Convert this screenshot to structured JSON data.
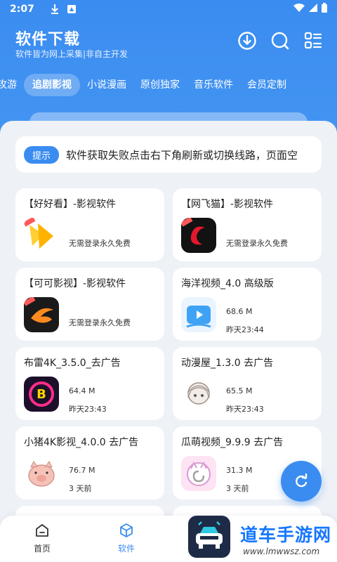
{
  "status_bar": {
    "time": "2:07"
  },
  "header": {
    "title": "软件下载",
    "subtitle": "软件皆为网上采集|非自主开发",
    "icons": [
      "download-icon",
      "search-icon",
      "menu-icon"
    ]
  },
  "tabs": [
    {
      "label": "攻游",
      "active": false
    },
    {
      "label": "追剧影视",
      "active": true
    },
    {
      "label": "小说漫画",
      "active": false
    },
    {
      "label": "原创独家",
      "active": false
    },
    {
      "label": "音乐软件",
      "active": false
    },
    {
      "label": "会员定制",
      "active": false
    }
  ],
  "notice": {
    "badge": "提示",
    "text": "软件获取失败点击右下角刷新或切换线路，页面空"
  },
  "apps": [
    {
      "title": "【好好看】-影视软件",
      "line1": "",
      "line2": "",
      "free": "无需登录永久免费",
      "icon": "haohaokan"
    },
    {
      "title": "【网飞猫】-影视软件",
      "line1": "",
      "line2": "",
      "free": "无需登录永久免费",
      "icon": "wangfeimao"
    },
    {
      "title": "【可可影视】-影视软件",
      "line1": "",
      "line2": "",
      "free": "无需登录永久免费",
      "icon": "keke"
    },
    {
      "title": "海洋视频_4.0 高级版",
      "line1": "68.6 M",
      "line2": "昨天23:44",
      "free": "",
      "icon": "haiyang"
    },
    {
      "title": "布雷4K_3.5.0_去广告",
      "line1": "64.4 M",
      "line2": "昨天23:43",
      "free": "",
      "icon": "bulei"
    },
    {
      "title": "动漫屋_1.3.0 去广告",
      "line1": "65.5 M",
      "line2": "昨天23:43",
      "free": "",
      "icon": "dongmanwu"
    },
    {
      "title": "小猪4K影视_4.0.0 去广告",
      "line1": "76.7 M",
      "line2": "3 天前",
      "free": "",
      "icon": "xiaozhu"
    },
    {
      "title": "瓜萌视频_9.9.9 去广告",
      "line1": "31.3 M",
      "line2": "3 天前",
      "free": "",
      "icon": "guameng"
    }
  ],
  "bottom_nav": {
    "home": "首页",
    "software": "软件"
  },
  "watermark": {
    "text": "道车手游网",
    "url": "www.lmwwsz.com"
  },
  "colors": {
    "primary": "#3a8cf0",
    "background": "#eef1f6"
  }
}
